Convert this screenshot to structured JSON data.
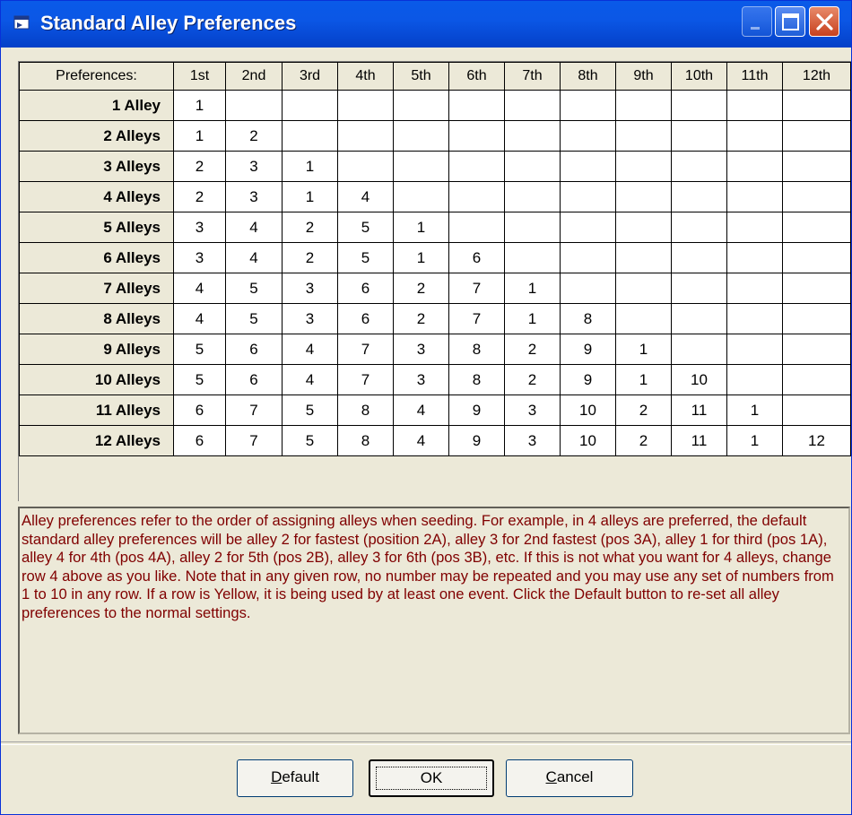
{
  "window": {
    "title": "Standard Alley Preferences",
    "title_icon": "app-window-icon",
    "controls": [
      "minimize-icon",
      "maximize-icon",
      "close-icon"
    ]
  },
  "grid": {
    "header_label": "Preferences:",
    "columns": [
      "1st",
      "2nd",
      "3rd",
      "4th",
      "5th",
      "6th",
      "7th",
      "8th",
      "9th",
      "10th",
      "11th",
      "12th"
    ],
    "rows": [
      {
        "label": "1 Alley",
        "values": [
          "1",
          "",
          "",
          "",
          "",
          "",
          "",
          "",
          "",
          "",
          "",
          ""
        ]
      },
      {
        "label": "2 Alleys",
        "values": [
          "1",
          "2",
          "",
          "",
          "",
          "",
          "",
          "",
          "",
          "",
          "",
          ""
        ]
      },
      {
        "label": "3 Alleys",
        "values": [
          "2",
          "3",
          "1",
          "",
          "",
          "",
          "",
          "",
          "",
          "",
          "",
          ""
        ]
      },
      {
        "label": "4 Alleys",
        "values": [
          "2",
          "3",
          "1",
          "4",
          "",
          "",
          "",
          "",
          "",
          "",
          "",
          ""
        ]
      },
      {
        "label": "5 Alleys",
        "values": [
          "3",
          "4",
          "2",
          "5",
          "1",
          "",
          "",
          "",
          "",
          "",
          "",
          ""
        ]
      },
      {
        "label": "6 Alleys",
        "values": [
          "3",
          "4",
          "2",
          "5",
          "1",
          "6",
          "",
          "",
          "",
          "",
          "",
          ""
        ]
      },
      {
        "label": "7 Alleys",
        "values": [
          "4",
          "5",
          "3",
          "6",
          "2",
          "7",
          "1",
          "",
          "",
          "",
          "",
          ""
        ]
      },
      {
        "label": "8 Alleys",
        "values": [
          "4",
          "5",
          "3",
          "6",
          "2",
          "7",
          "1",
          "8",
          "",
          "",
          "",
          ""
        ]
      },
      {
        "label": "9 Alleys",
        "values": [
          "5",
          "6",
          "4",
          "7",
          "3",
          "8",
          "2",
          "9",
          "1",
          "",
          "",
          ""
        ]
      },
      {
        "label": "10 Alleys",
        "values": [
          "5",
          "6",
          "4",
          "7",
          "3",
          "8",
          "2",
          "9",
          "1",
          "10",
          "",
          ""
        ]
      },
      {
        "label": "11 Alleys",
        "values": [
          "6",
          "7",
          "5",
          "8",
          "4",
          "9",
          "3",
          "10",
          "2",
          "11",
          "1",
          ""
        ]
      },
      {
        "label": "12 Alleys",
        "values": [
          "6",
          "7",
          "5",
          "8",
          "4",
          "9",
          "3",
          "10",
          "2",
          "11",
          "1",
          "12"
        ]
      }
    ]
  },
  "description": {
    "text": "Alley preferences refer to the order of assigning alleys when seeding.  For example, in 4 alleys are preferred, the default standard alley preferences will be alley 2 for fastest (position 2A), alley 3 for 2nd fastest (pos 3A), alley 1 for third (pos 1A), alley 4 for 4th (pos 4A), alley 2 for 5th (pos 2B), alley 3 for 6th (pos 3B), etc.  If this is not what you want for 4 alleys, change row 4 above as you like.  Note that in any given row, no number may be repeated and you may use any set of numbers from 1 to 10 in any row.  If a row is Yellow, it is being used by at least one event.  Click the Default button to re-set all alley preferences to the normal settings.",
    "color": "#800000"
  },
  "buttons": {
    "default_label": "Default",
    "ok_label": "OK",
    "cancel_label": "Cancel"
  },
  "colors": {
    "titlebar": "#0a5ae8",
    "dialog_bg": "#ece9d8",
    "close_button": "#c7411e"
  }
}
